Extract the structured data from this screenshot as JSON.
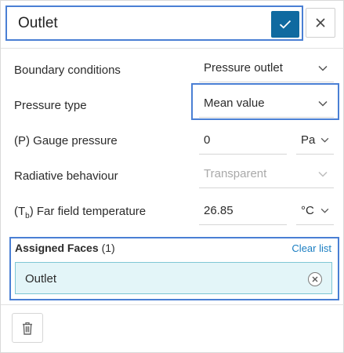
{
  "header": {
    "name_value": "Outlet"
  },
  "rows": [
    {
      "label": "Boundary conditions",
      "value": "Pressure outlet"
    },
    {
      "label": "Pressure type",
      "value": "Mean value"
    },
    {
      "label": "(P) Gauge pressure",
      "value": "0",
      "unit": "Pa"
    },
    {
      "label": "Radiative behaviour",
      "value": "Transparent"
    },
    {
      "label_pre": "(T",
      "label_sub": "b",
      "label_post": ") Far field temperature",
      "value": "26.85",
      "unit": "°C"
    }
  ],
  "assigned_faces": {
    "title": "Assigned Faces",
    "count": "(1)",
    "clear_label": "Clear list",
    "items": [
      {
        "label": "Outlet"
      }
    ]
  },
  "colors": {
    "accent": "#0f6aa0",
    "highlight": "#4a7fd4",
    "link": "#1b7ec2",
    "chip_bg": "#e3f5f8"
  },
  "icons": {
    "confirm": "checkmark-icon",
    "close": "close-icon",
    "dropdown": "chevron-down-icon",
    "remove": "remove-circle-icon",
    "delete": "trash-icon"
  }
}
